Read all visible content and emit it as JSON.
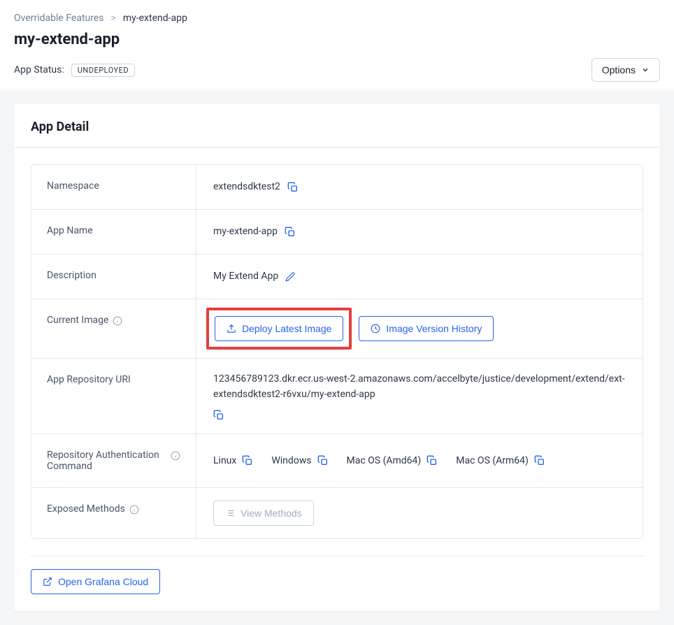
{
  "breadcrumb": {
    "parent": "Overridable Features",
    "current": "my-extend-app"
  },
  "page_title": "my-extend-app",
  "status": {
    "label": "App Status:",
    "value": "UNDEPLOYED"
  },
  "options_button": "Options",
  "card_title": "App Detail",
  "details": {
    "namespace": {
      "label": "Namespace",
      "value": "extendsdktest2"
    },
    "app_name": {
      "label": "App Name",
      "value": "my-extend-app"
    },
    "description": {
      "label": "Description",
      "value": "My Extend App"
    },
    "current_image": {
      "label": "Current Image",
      "deploy_button": "Deploy Latest Image",
      "history_button": "Image Version History"
    },
    "repo_uri": {
      "label": "App Repository URI",
      "value": "123456789123.dkr.ecr.us-west-2.amazonaws.com/accelbyte/justice/development/extend/ext-extendsdktest2-r6vxu/my-extend-app"
    },
    "repo_auth": {
      "label": "Repository Authentication Command",
      "os": [
        "Linux",
        "Windows",
        "Mac OS (Amd64)",
        "Mac OS (Arm64)"
      ]
    },
    "exposed_methods": {
      "label": "Exposed Methods",
      "button": "View Methods"
    }
  },
  "grafana_button": "Open Grafana Cloud"
}
